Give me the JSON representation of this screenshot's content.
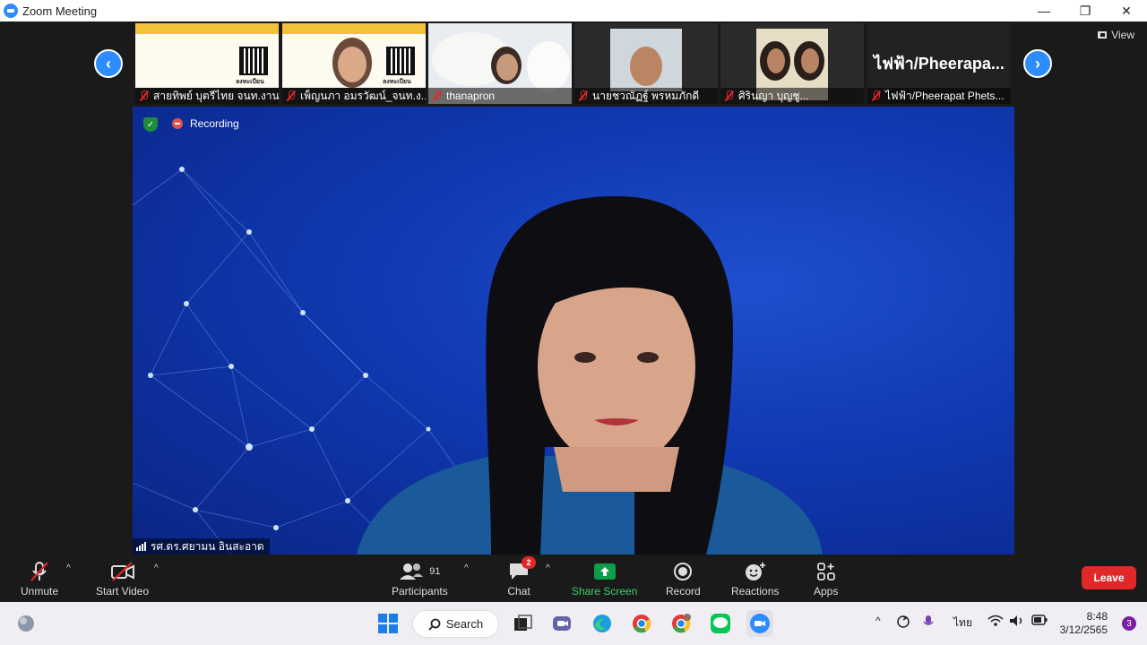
{
  "window": {
    "title": "Zoom Meeting",
    "minimize": "—",
    "maximize": "❐",
    "close": "✕"
  },
  "gallery": {
    "view_label": "View",
    "participants": [
      {
        "name": "สายทิพย์ บุตรีไทย จนท.งาน...",
        "muted": true
      },
      {
        "name": "เพ็ญนภา อมรวัฒน์_จนท.ง...",
        "muted": true
      },
      {
        "name": "thanapron",
        "muted": true
      },
      {
        "name": "นายชวณัฏฐ์ พรหมภักดี",
        "muted": true
      },
      {
        "name": "ศิรินญา บุญชู...",
        "muted": true
      },
      {
        "name": "ไฟฟ้า/Pheerapat Phets...",
        "muted": true,
        "display_text": "ไฟฟ้า/Pheerapa..."
      }
    ],
    "poster_qr_label": "ลงทะเบียน"
  },
  "speaker": {
    "name": "รศ.ดร.ศยามน อินสะอาด",
    "recording_label": "Recording"
  },
  "toolbar": {
    "unmute": "Unmute",
    "start_video": "Start Video",
    "participants": "Participants",
    "participants_count": "91",
    "chat": "Chat",
    "chat_badge": "2",
    "share_screen": "Share Screen",
    "record": "Record",
    "reactions": "Reactions",
    "apps": "Apps",
    "leave": "Leave"
  },
  "taskbar": {
    "search_label": "Search",
    "language": "ไทย",
    "time": "8:48",
    "date": "3/12/2565",
    "notification_count": "3"
  },
  "colors": {
    "accent": "#2d8cff",
    "leave": "#e02828",
    "share": "#0e9e4b",
    "speaker_bg": "#1038b0"
  }
}
